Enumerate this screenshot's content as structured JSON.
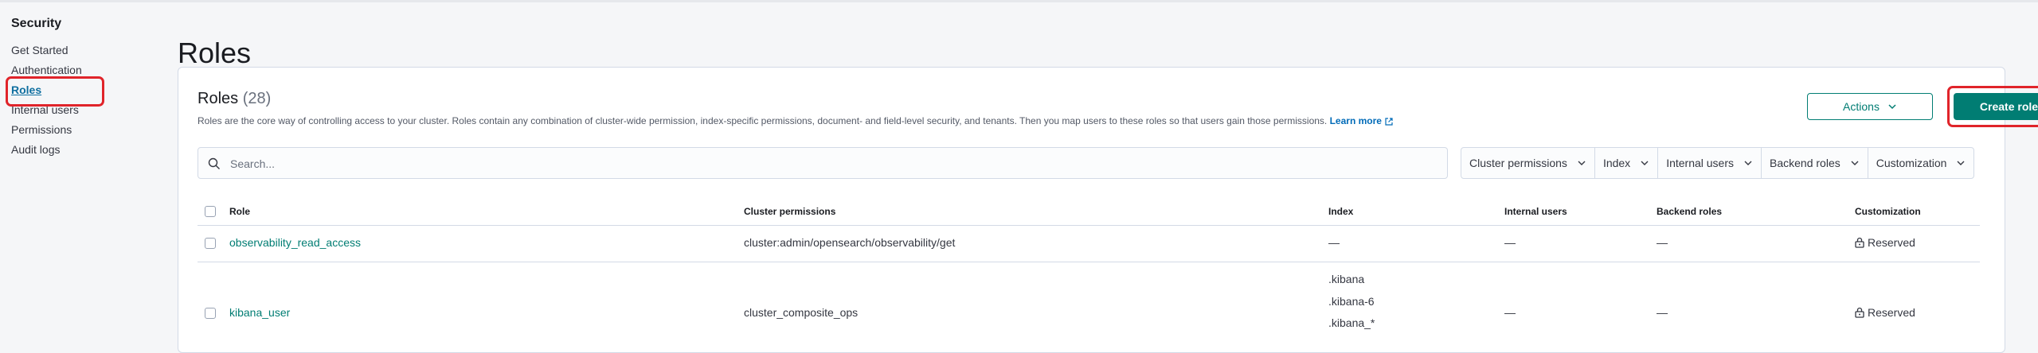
{
  "sidebar": {
    "title": "Security",
    "items": [
      {
        "label": "Get Started"
      },
      {
        "label": "Authentication"
      },
      {
        "label": "Roles"
      },
      {
        "label": "Internal users"
      },
      {
        "label": "Permissions"
      },
      {
        "label": "Audit logs"
      }
    ]
  },
  "page": {
    "title": "Roles"
  },
  "panel": {
    "title": "Roles",
    "count": "(28)",
    "description": "Roles are the core way of controlling access to your cluster. Roles contain any combination of cluster-wide permission, index-specific permissions, document- and field-level security, and tenants. Then you map users to these roles so that users gain those permissions.",
    "learn_more": "Learn more",
    "actions_label": "Actions",
    "create_label": "Create role"
  },
  "search": {
    "placeholder": "Search..."
  },
  "filters": [
    "Cluster permissions",
    "Index",
    "Internal users",
    "Backend roles",
    "Customization"
  ],
  "table": {
    "columns": [
      "Role",
      "Cluster permissions",
      "Index",
      "Internal users",
      "Backend roles",
      "Customization"
    ],
    "rows": [
      {
        "role": "observability_read_access",
        "cluster_permissions": "cluster:admin/opensearch/observability/get",
        "index": [
          "—"
        ],
        "internal_users": "—",
        "backend_roles": "—",
        "customization": "Reserved"
      },
      {
        "role": "kibana_user",
        "cluster_permissions": "cluster_composite_ops",
        "index": [
          ".kibana",
          ".kibana-6",
          ".kibana_*"
        ],
        "internal_users": "—",
        "backend_roles": "—",
        "customization": "Reserved"
      }
    ]
  },
  "colors": {
    "accent": "#017d73",
    "highlight": "#e0242a",
    "link": "#006bb8"
  }
}
